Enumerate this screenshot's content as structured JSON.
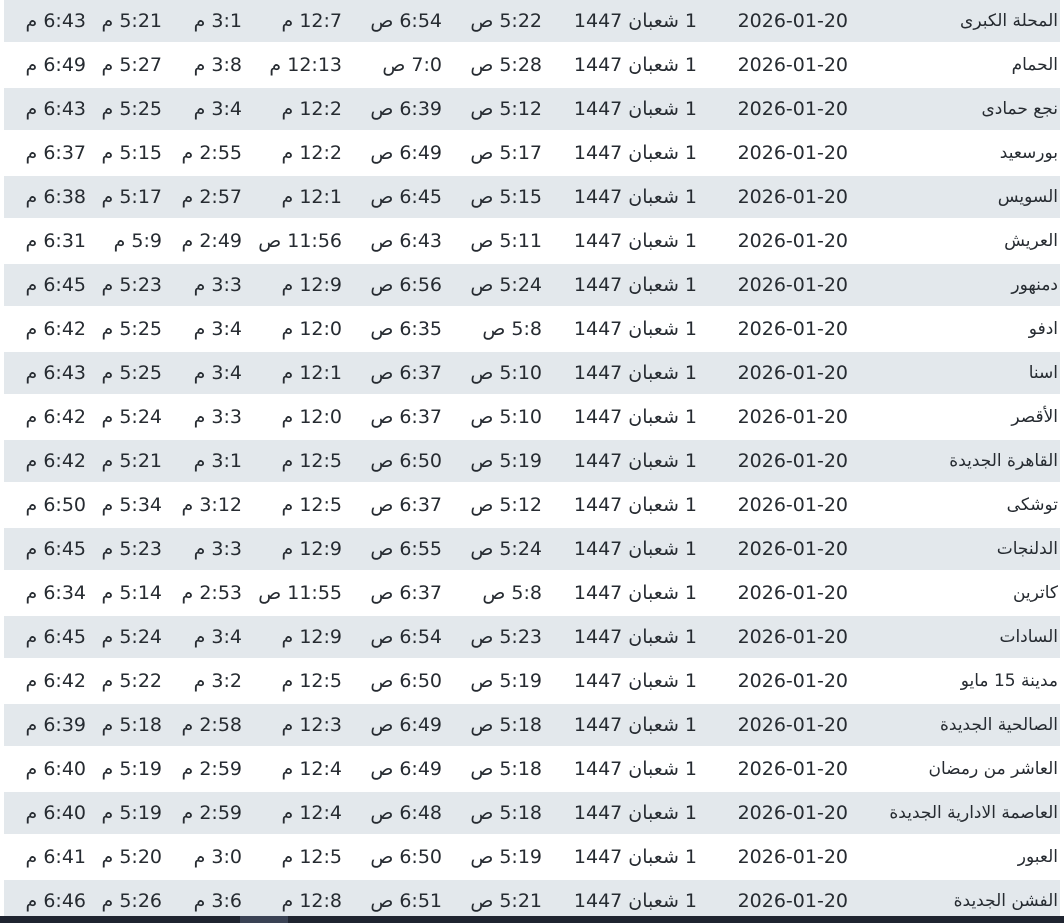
{
  "table": {
    "rows": [
      {
        "city": "المحلة الكبرى",
        "date": "2026-01-20",
        "hijri": "1 شعبان 1447",
        "fajr": "5:22 ص",
        "sunrise": "6:54 ص",
        "dhuhr": "12:7 م",
        "asr": "3:1 م",
        "maghrib": "5:21 م",
        "isha": "6:43 م"
      },
      {
        "city": "الحمام",
        "date": "2026-01-20",
        "hijri": "1 شعبان 1447",
        "fajr": "5:28 ص",
        "sunrise": "7:0 ص",
        "dhuhr": "12:13 م",
        "asr": "3:8 م",
        "maghrib": "5:27 م",
        "isha": "6:49 م"
      },
      {
        "city": "نجع حمادى",
        "date": "2026-01-20",
        "hijri": "1 شعبان 1447",
        "fajr": "5:12 ص",
        "sunrise": "6:39 ص",
        "dhuhr": "12:2 م",
        "asr": "3:4 م",
        "maghrib": "5:25 م",
        "isha": "6:43 م"
      },
      {
        "city": "بورسعيد",
        "date": "2026-01-20",
        "hijri": "1 شعبان 1447",
        "fajr": "5:17 ص",
        "sunrise": "6:49 ص",
        "dhuhr": "12:2 م",
        "asr": "2:55 م",
        "maghrib": "5:15 م",
        "isha": "6:37 م"
      },
      {
        "city": "السويس",
        "date": "2026-01-20",
        "hijri": "1 شعبان 1447",
        "fajr": "5:15 ص",
        "sunrise": "6:45 ص",
        "dhuhr": "12:1 م",
        "asr": "2:57 م",
        "maghrib": "5:17 م",
        "isha": "6:38 م"
      },
      {
        "city": "العريش",
        "date": "2026-01-20",
        "hijri": "1 شعبان 1447",
        "fajr": "5:11 ص",
        "sunrise": "6:43 ص",
        "dhuhr": "11:56 ص",
        "asr": "2:49 م",
        "maghrib": "5:9 م",
        "isha": "6:31 م"
      },
      {
        "city": "دمنهور",
        "date": "2026-01-20",
        "hijri": "1 شعبان 1447",
        "fajr": "5:24 ص",
        "sunrise": "6:56 ص",
        "dhuhr": "12:9 م",
        "asr": "3:3 م",
        "maghrib": "5:23 م",
        "isha": "6:45 م"
      },
      {
        "city": "ادفو",
        "date": "2026-01-20",
        "hijri": "1 شعبان 1447",
        "fajr": "5:8 ص",
        "sunrise": "6:35 ص",
        "dhuhr": "12:0 م",
        "asr": "3:4 م",
        "maghrib": "5:25 م",
        "isha": "6:42 م"
      },
      {
        "city": "اسنا",
        "date": "2026-01-20",
        "hijri": "1 شعبان 1447",
        "fajr": "5:10 ص",
        "sunrise": "6:37 ص",
        "dhuhr": "12:1 م",
        "asr": "3:4 م",
        "maghrib": "5:25 م",
        "isha": "6:43 م"
      },
      {
        "city": "الأقصر",
        "date": "2026-01-20",
        "hijri": "1 شعبان 1447",
        "fajr": "5:10 ص",
        "sunrise": "6:37 ص",
        "dhuhr": "12:0 م",
        "asr": "3:3 م",
        "maghrib": "5:24 م",
        "isha": "6:42 م"
      },
      {
        "city": "القاهرة الجديدة",
        "date": "2026-01-20",
        "hijri": "1 شعبان 1447",
        "fajr": "5:19 ص",
        "sunrise": "6:50 ص",
        "dhuhr": "12:5 م",
        "asr": "3:1 م",
        "maghrib": "5:21 م",
        "isha": "6:42 م"
      },
      {
        "city": "توشكى",
        "date": "2026-01-20",
        "hijri": "1 شعبان 1447",
        "fajr": "5:12 ص",
        "sunrise": "6:37 ص",
        "dhuhr": "12:5 م",
        "asr": "3:12 م",
        "maghrib": "5:34 م",
        "isha": "6:50 م"
      },
      {
        "city": "الدلنجات",
        "date": "2026-01-20",
        "hijri": "1 شعبان 1447",
        "fajr": "5:24 ص",
        "sunrise": "6:55 ص",
        "dhuhr": "12:9 م",
        "asr": "3:3 م",
        "maghrib": "5:23 م",
        "isha": "6:45 م"
      },
      {
        "city": "كاترين",
        "date": "2026-01-20",
        "hijri": "1 شعبان 1447",
        "fajr": "5:8 ص",
        "sunrise": "6:37 ص",
        "dhuhr": "11:55 ص",
        "asr": "2:53 م",
        "maghrib": "5:14 م",
        "isha": "6:34 م"
      },
      {
        "city": "السادات",
        "date": "2026-01-20",
        "hijri": "1 شعبان 1447",
        "fajr": "5:23 ص",
        "sunrise": "6:54 ص",
        "dhuhr": "12:9 م",
        "asr": "3:4 م",
        "maghrib": "5:24 م",
        "isha": "6:45 م"
      },
      {
        "city": "مدينة 15 مايو",
        "date": "2026-01-20",
        "hijri": "1 شعبان 1447",
        "fajr": "5:19 ص",
        "sunrise": "6:50 ص",
        "dhuhr": "12:5 م",
        "asr": "3:2 م",
        "maghrib": "5:22 م",
        "isha": "6:42 م"
      },
      {
        "city": "الصالحية الجديدة",
        "date": "2026-01-20",
        "hijri": "1 شعبان 1447",
        "fajr": "5:18 ص",
        "sunrise": "6:49 ص",
        "dhuhr": "12:3 م",
        "asr": "2:58 م",
        "maghrib": "5:18 م",
        "isha": "6:39 م"
      },
      {
        "city": "العاشر من رمضان",
        "date": "2026-01-20",
        "hijri": "1 شعبان 1447",
        "fajr": "5:18 ص",
        "sunrise": "6:49 ص",
        "dhuhr": "12:4 م",
        "asr": "2:59 م",
        "maghrib": "5:19 م",
        "isha": "6:40 م"
      },
      {
        "city": "العاصمة الادارية الجديدة",
        "date": "2026-01-20",
        "hijri": "1 شعبان 1447",
        "fajr": "5:18 ص",
        "sunrise": "6:48 ص",
        "dhuhr": "12:4 م",
        "asr": "2:59 م",
        "maghrib": "5:19 م",
        "isha": "6:40 م"
      },
      {
        "city": "العبور",
        "date": "2026-01-20",
        "hijri": "1 شعبان 1447",
        "fajr": "5:19 ص",
        "sunrise": "6:50 ص",
        "dhuhr": "12:5 م",
        "asr": "3:0 م",
        "maghrib": "5:20 م",
        "isha": "6:41 م"
      },
      {
        "city": "الفشن الجديدة",
        "date": "2026-01-20",
        "hijri": "1 شعبان 1447",
        "fajr": "5:21 ص",
        "sunrise": "6:51 ص",
        "dhuhr": "12:8 م",
        "asr": "3:6 م",
        "maghrib": "5:26 م",
        "isha": "6:46 م"
      }
    ]
  },
  "colors": {
    "row_alt_bg": "#e3e8ec",
    "text": "#262b31",
    "scrollbar_track": "#1f2430",
    "scrollbar_thumb": "#3a4254"
  }
}
